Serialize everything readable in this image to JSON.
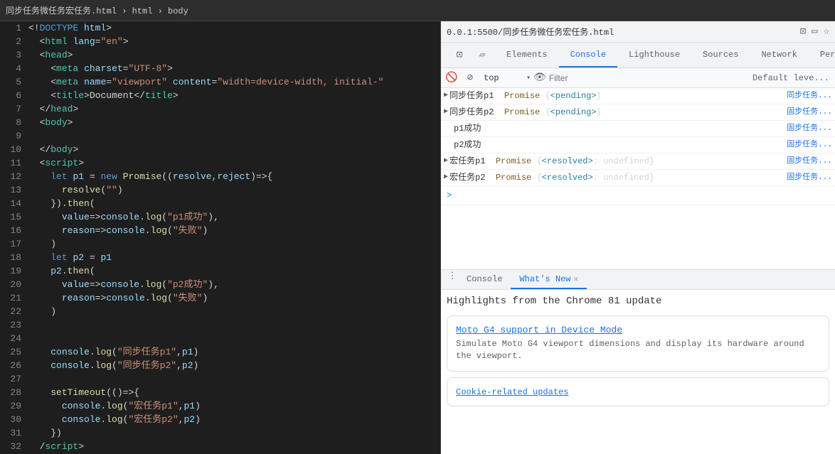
{
  "browser": {
    "breadcrumb": "同步任务微任务宏任务.html › html › body",
    "url": "0.0.1:5500/同步任务微任务宏任务.html"
  },
  "editor": {
    "lines": [
      {
        "num": 1,
        "content": "<!DOCTYPE html>"
      },
      {
        "num": 2,
        "content": "  <html lang=\"en\">"
      },
      {
        "num": 3,
        "content": "  <head>"
      },
      {
        "num": 4,
        "content": "    <meta charset=\"UTF-8\">"
      },
      {
        "num": 5,
        "content": "    <meta name=\"viewport\" content=\"width=device-width, initial-\""
      },
      {
        "num": 6,
        "content": "    <title>Document</title>"
      },
      {
        "num": 7,
        "content": "  </head>"
      },
      {
        "num": 8,
        "content": "  <body>"
      },
      {
        "num": 9,
        "content": ""
      },
      {
        "num": 10,
        "content": "  </body>"
      },
      {
        "num": 11,
        "content": "  <script>"
      },
      {
        "num": 12,
        "content": "    let p1 = new Promise((resolve,reject)=>{"
      },
      {
        "num": 13,
        "content": "      resolve(\"\")"
      },
      {
        "num": 14,
        "content": "    }).then("
      },
      {
        "num": 15,
        "content": "      value=>console.log(\"p1成功\"),"
      },
      {
        "num": 16,
        "content": "      reason=>console.log(\"失败\")"
      },
      {
        "num": 17,
        "content": "    )"
      },
      {
        "num": 18,
        "content": "    let p2 = p1"
      },
      {
        "num": 19,
        "content": "    p2.then("
      },
      {
        "num": 20,
        "content": "      value=>console.log(\"p2成功\"),"
      },
      {
        "num": 21,
        "content": "      reason=>console.log(\"失败\")"
      },
      {
        "num": 22,
        "content": "    )"
      },
      {
        "num": 23,
        "content": ""
      },
      {
        "num": 24,
        "content": "  "
      },
      {
        "num": 25,
        "content": "    console.log(\"同步任务p1\",p1)"
      },
      {
        "num": 26,
        "content": "    console.log(\"同步任务p2\",p2)"
      },
      {
        "num": 27,
        "content": ""
      },
      {
        "num": 28,
        "content": "    setTimeout(()=>{"
      },
      {
        "num": 29,
        "content": "      console.log(\"宏任务p1\",p1)"
      },
      {
        "num": 30,
        "content": "      console.log(\"宏任务p2\",p2)"
      },
      {
        "num": 31,
        "content": "    })"
      },
      {
        "num": 32,
        "content": "  /script>"
      }
    ]
  },
  "devtools": {
    "tabs": [
      {
        "id": "elements",
        "label": "Elements",
        "active": false
      },
      {
        "id": "console",
        "label": "Console",
        "active": true
      },
      {
        "id": "lighthouse",
        "label": "Lighthouse",
        "active": false
      },
      {
        "id": "sources",
        "label": "Sources",
        "active": false
      },
      {
        "id": "network",
        "label": "Network",
        "active": false
      },
      {
        "id": "performance",
        "label": "Perfor...",
        "active": false
      }
    ],
    "toolbar": {
      "context": "top",
      "filter_placeholder": "Filter",
      "default_level": "Default leve..."
    },
    "console_rows": [
      {
        "text": "同步任务p1 ► Promise {<pending>}",
        "source": "同步任务...",
        "has_triangle": true,
        "type": "promise_pending"
      },
      {
        "text": "同步任务p2 ► Promise {<pending>}",
        "source": "固步任务...",
        "has_triangle": true,
        "type": "promise_pending"
      },
      {
        "text": "p1成功",
        "source": "固步任务...",
        "has_triangle": false,
        "type": "normal"
      },
      {
        "text": "p2成功",
        "source": "固步任务...",
        "has_triangle": false,
        "type": "normal"
      },
      {
        "text": "宏任务p1 ► Promise {<resolved>: undefined}",
        "source": "固步任务...",
        "has_triangle": true,
        "type": "promise_resolved"
      },
      {
        "text": "宏任务p2 ► Promise {<resolved>: undefined}",
        "source": "固步任务...",
        "has_triangle": true,
        "type": "promise_resolved"
      }
    ],
    "console_input_arrow": ">"
  },
  "bottom_panel": {
    "tabs": [
      {
        "id": "console",
        "label": "Console",
        "active": false,
        "closable": false
      },
      {
        "id": "whats-new",
        "label": "What's New",
        "active": true,
        "closable": true
      }
    ],
    "whats_new": {
      "title": "Highlights from the Chrome 81 update",
      "card1": {
        "link": "Moto G4 support in Device Mode",
        "desc": "Simulate Moto G4 viewport dimensions and display its hardware around the viewport."
      },
      "card2": {
        "link": "Cookie-related updates"
      }
    }
  }
}
